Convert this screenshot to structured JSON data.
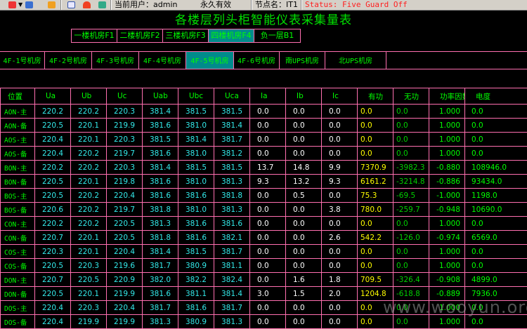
{
  "toolbar": {
    "user": "当前用户：admin",
    "license": "永久有效",
    "node": "节点名：IT1",
    "status": "Status: Five Guard Off",
    "colors": {
      "status": "#ff2020"
    }
  },
  "title": "各楼层列头柜智能仪表采集量表",
  "floor_tabs": [
    "一楼机房F1",
    "二楼机房F2",
    "三楼机房F3",
    "四楼机房F4",
    "负一层B1"
  ],
  "floor_active": 3,
  "room_tabs": [
    "4F-1号机房",
    "4F-2号机房",
    "4F-3号机房",
    "4F-4号机房",
    "4F-5号机房",
    "4F-6号机房",
    "南UPS机房",
    "北UPS机房"
  ],
  "room_active": 4,
  "table": {
    "headers": [
      "位置",
      "Ua",
      "Ub",
      "Uc",
      "Uab",
      "Ubc",
      "Uca",
      "Ia",
      "Ib",
      "Ic",
      "有功",
      "无功",
      "功率因数",
      "电度"
    ],
    "rows": [
      [
        "AON-主",
        "220.2",
        "220.2",
        "220.3",
        "381.4",
        "381.5",
        "381.5",
        "0.0",
        "0.0",
        "0.0",
        "0.0",
        "0.0",
        "1.000",
        "0.0"
      ],
      [
        "AON-备",
        "220.5",
        "220.1",
        "219.9",
        "381.6",
        "381.0",
        "381.4",
        "0.0",
        "0.0",
        "0.0",
        "0.0",
        "0.0",
        "1.000",
        "0.0"
      ],
      [
        "AOS-主",
        "220.4",
        "220.1",
        "220.3",
        "381.5",
        "381.4",
        "381.7",
        "0.0",
        "0.0",
        "0.0",
        "0.0",
        "0.0",
        "1.000",
        "0.0"
      ],
      [
        "AOS-备",
        "220.4",
        "220.2",
        "219.7",
        "381.6",
        "381.0",
        "381.2",
        "0.0",
        "0.0",
        "0.0",
        "0.0",
        "0.0",
        "1.000",
        "0.0"
      ],
      [
        "BON-主",
        "220.2",
        "220.2",
        "220.3",
        "381.4",
        "381.5",
        "381.5",
        "13.7",
        "14.8",
        "9.9",
        "7370.9",
        "-3982.3",
        "-0.880",
        "108946.0"
      ],
      [
        "BON-备",
        "220.5",
        "220.1",
        "219.8",
        "381.6",
        "381.0",
        "381.3",
        "9.3",
        "13.2",
        "9.3",
        "6161.2",
        "-3214.8",
        "-0.886",
        "93434.0"
      ],
      [
        "BOS-主",
        "220.5",
        "220.2",
        "220.4",
        "381.6",
        "381.6",
        "381.8",
        "0.0",
        "0.5",
        "0.0",
        "75.3",
        "-69.5",
        "-1.000",
        "1198.0"
      ],
      [
        "BOS-备",
        "220.6",
        "220.2",
        "219.7",
        "381.8",
        "381.0",
        "381.3",
        "0.0",
        "0.0",
        "3.8",
        "780.0",
        "-259.7",
        "-0.948",
        "10690.0"
      ],
      [
        "CON-主",
        "220.2",
        "220.2",
        "220.5",
        "381.3",
        "381.6",
        "381.6",
        "0.0",
        "0.0",
        "0.0",
        "0.0",
        "0.0",
        "1.000",
        "0.0"
      ],
      [
        "CON-备",
        "220.7",
        "220.1",
        "220.5",
        "381.8",
        "381.6",
        "382.1",
        "0.0",
        "0.0",
        "2.6",
        "542.2",
        "-126.0",
        "-0.974",
        "6569.0"
      ],
      [
        "COS-主",
        "220.3",
        "220.1",
        "220.4",
        "381.4",
        "381.5",
        "381.7",
        "0.0",
        "0.0",
        "0.0",
        "0.0",
        "0.0",
        "1.000",
        "0.0"
      ],
      [
        "COS-备",
        "220.5",
        "220.3",
        "219.6",
        "381.7",
        "380.9",
        "381.1",
        "0.0",
        "0.0",
        "0.0",
        "0.0",
        "0.0",
        "1.000",
        "0.0"
      ],
      [
        "DON-主",
        "220.7",
        "220.5",
        "220.9",
        "382.0",
        "382.2",
        "382.4",
        "0.0",
        "1.6",
        "1.8",
        "709.5",
        "-326.4",
        "-0.908",
        "4899.0"
      ],
      [
        "DON-备",
        "220.5",
        "220.1",
        "219.9",
        "381.6",
        "381.1",
        "381.4",
        "3.0",
        "1.5",
        "2.0",
        "1204.8",
        "-618.8",
        "-0.889",
        "7936.0"
      ],
      [
        "DOS-主",
        "220.4",
        "220.3",
        "220.4",
        "381.7",
        "381.6",
        "381.7",
        "0.0",
        "0.0",
        "0.0",
        "0.0",
        "0.0",
        "1.000",
        "0.0"
      ],
      [
        "DOS-备",
        "220.4",
        "219.9",
        "219.9",
        "381.3",
        "380.9",
        "381.3",
        "0.0",
        "0.0",
        "0.0",
        "0.0",
        "0.0",
        "1.000",
        "0.0"
      ]
    ]
  },
  "watermark": "www.wooyun.org"
}
